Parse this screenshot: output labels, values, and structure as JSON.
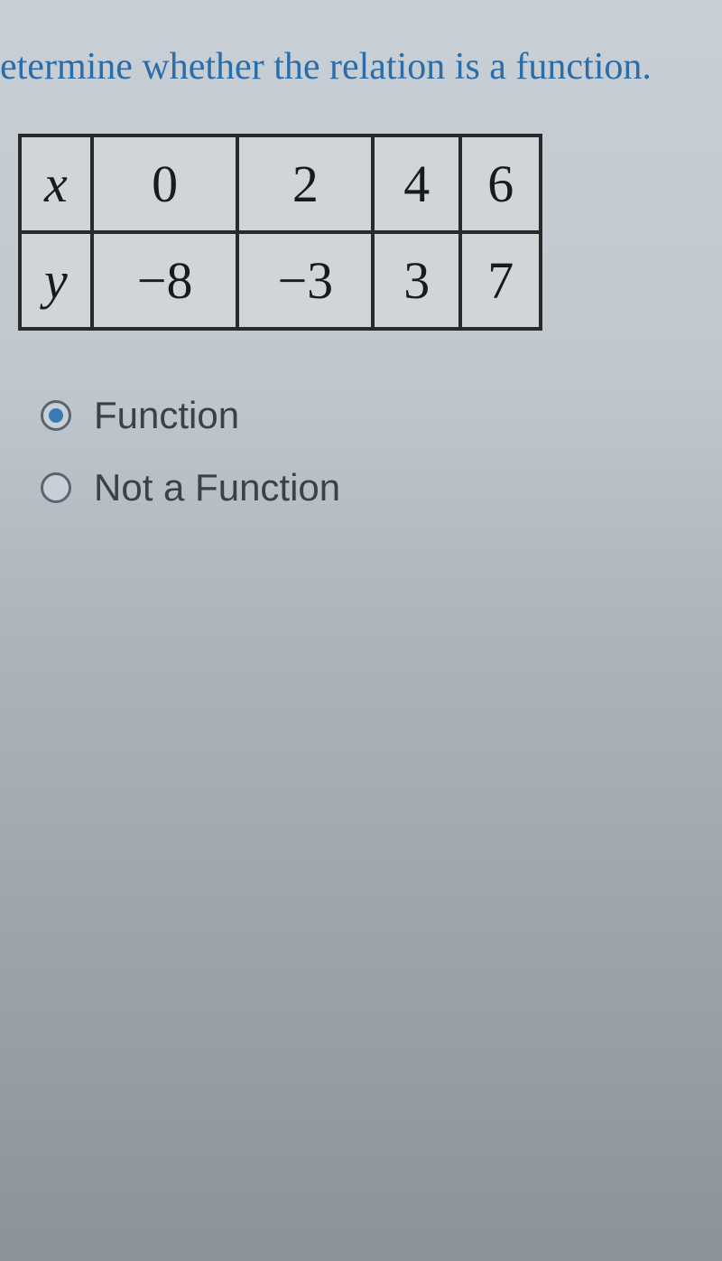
{
  "question": "etermine whether the relation is a function.",
  "table": {
    "rows": [
      {
        "label": "x",
        "values": [
          "0",
          "2",
          "4",
          "6"
        ]
      },
      {
        "label": "y",
        "values": [
          "−8",
          "−3",
          "3",
          "7"
        ]
      }
    ]
  },
  "options": [
    {
      "label": "Function",
      "selected": true
    },
    {
      "label": "Not a Function",
      "selected": false
    }
  ]
}
